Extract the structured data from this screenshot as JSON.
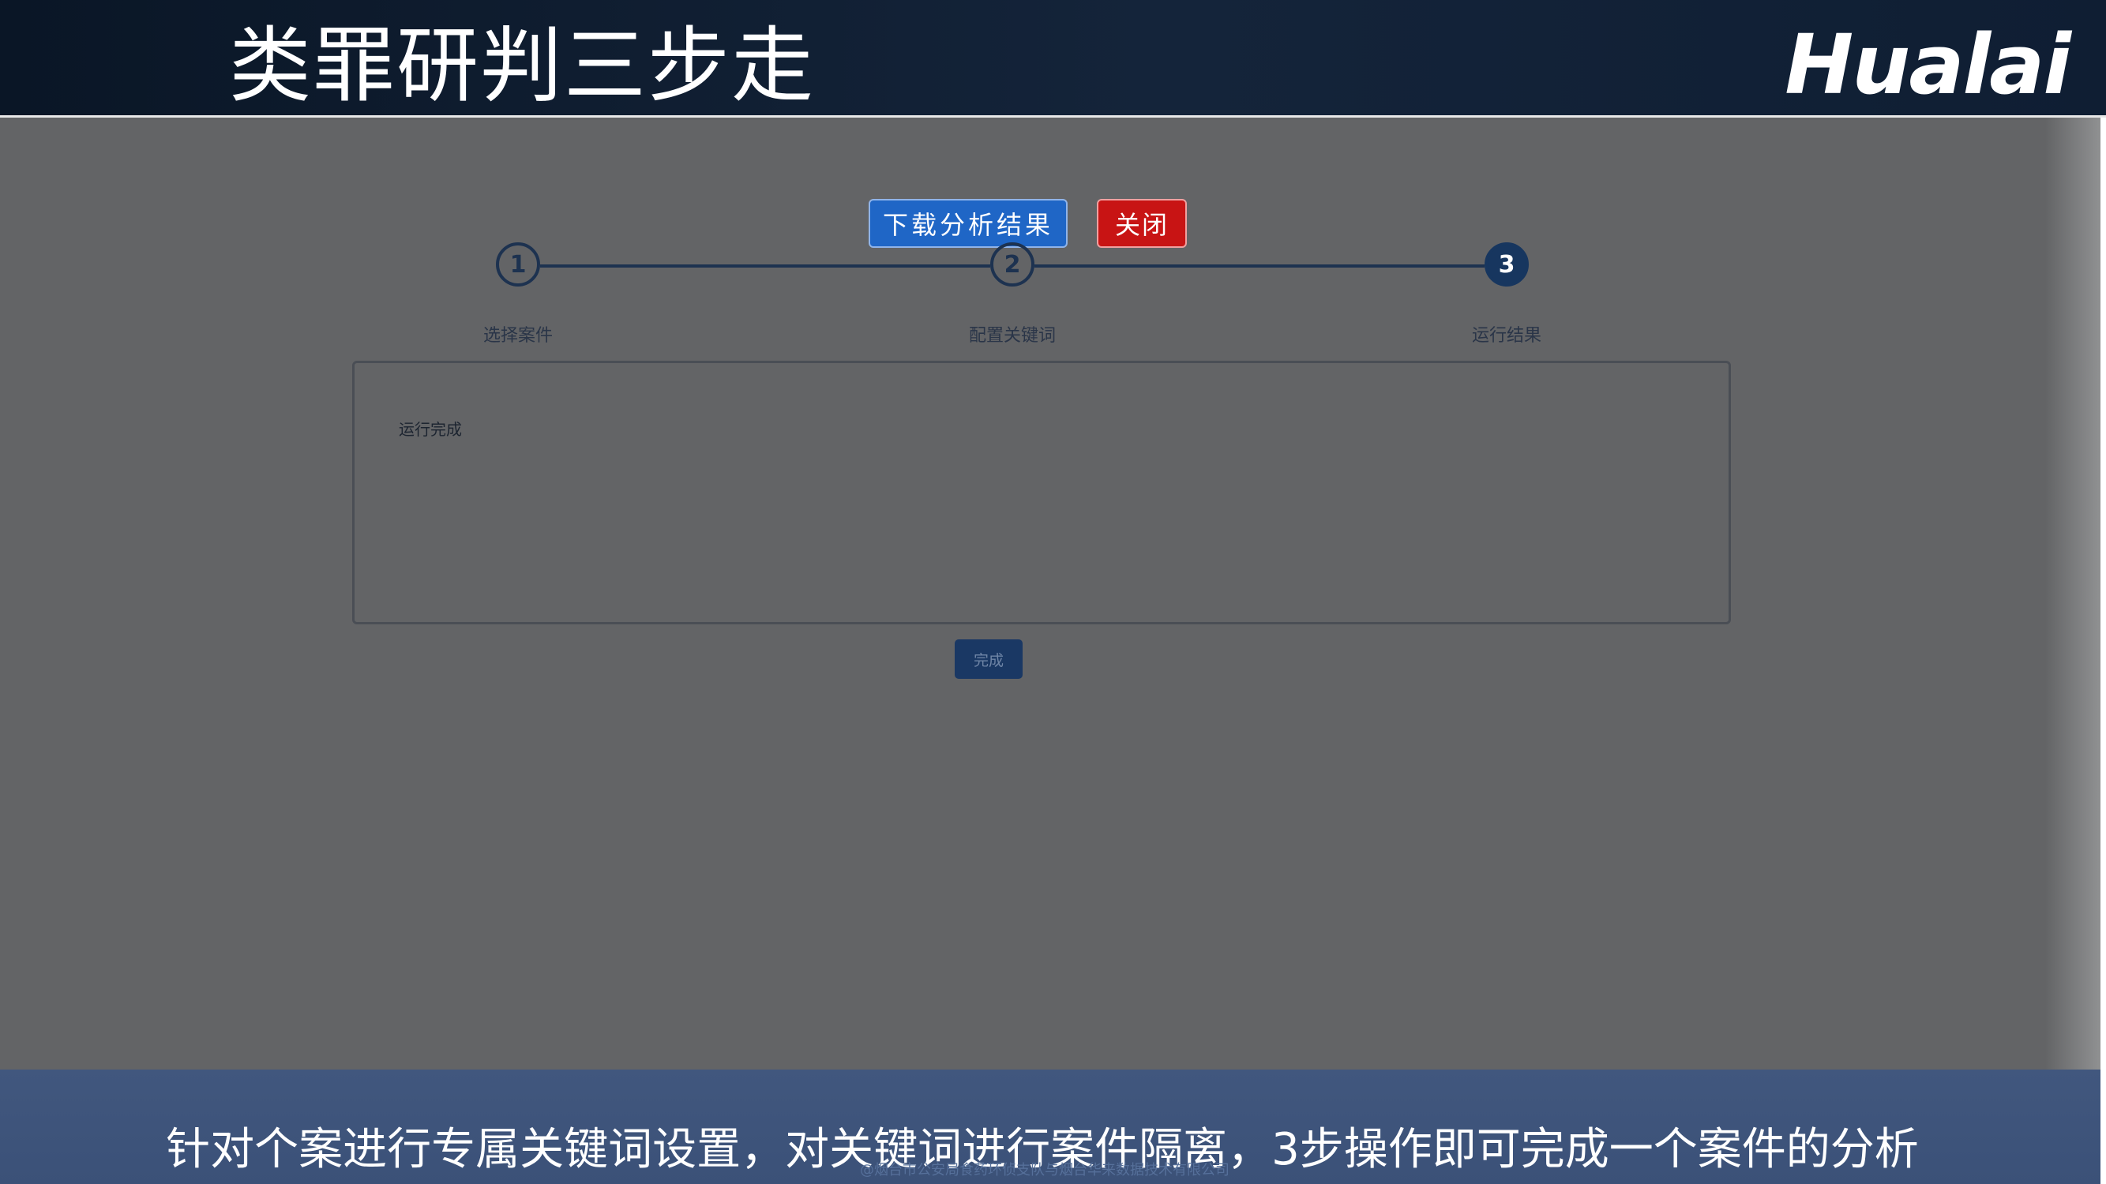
{
  "slide": {
    "title": "类罪研判三步走",
    "logo": "Hualai",
    "caption": "针对个案进行专属关键词设置，对关键词进行案件隔离，3步操作即可完成一个案件的分析",
    "footer": "@烟台市公安局食药环侦支队与烟台华来数据技术有限公司"
  },
  "toolbar": {
    "download_label": "下载分析结果",
    "close_label": "关闭"
  },
  "steps": [
    {
      "number": "1",
      "label": "选择案件",
      "active": false
    },
    {
      "number": "2",
      "label": "配置关键词",
      "active": false
    },
    {
      "number": "3",
      "label": "运行结果",
      "active": true
    }
  ],
  "result": {
    "status_text": "运行完成"
  },
  "actions": {
    "done_label": "完成"
  },
  "colors": {
    "header_bg": "#0f1e33",
    "stage_bg": "#636466",
    "download_button": "#1f66c6",
    "close_button": "#c81414",
    "step_active": "#17365f",
    "caption_bar": "#3e547b"
  }
}
